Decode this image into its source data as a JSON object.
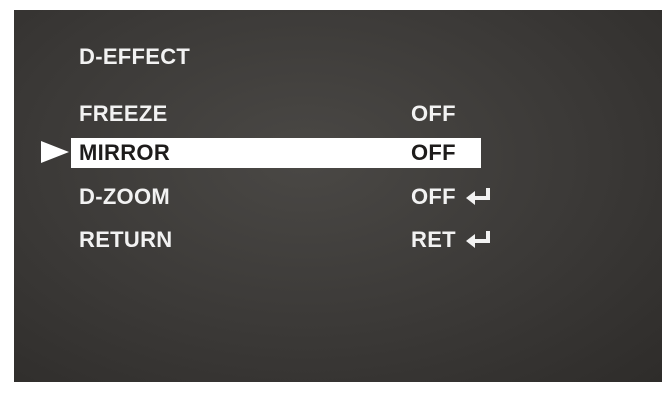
{
  "menu": {
    "title": "D-EFFECT",
    "items": [
      {
        "label": "FREEZE",
        "value": "OFF"
      },
      {
        "label": "MIRROR",
        "value": "OFF",
        "selected": true
      },
      {
        "label": "D-ZOOM",
        "value": "OFF",
        "icon": "enter-icon"
      },
      {
        "label": "RETURN",
        "value": "RET",
        "icon": "enter-icon"
      }
    ]
  },
  "colors": {
    "background": "#3b3937",
    "text": "#f2f2f2",
    "highlight": "#ffffff",
    "highlight_text": "#1e1c1b"
  }
}
